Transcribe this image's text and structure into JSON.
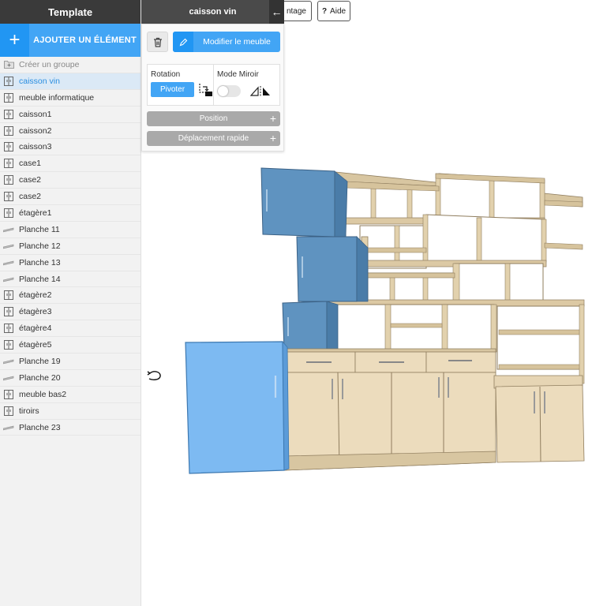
{
  "sidebar": {
    "title": "Template",
    "add_button": {
      "icon": "plus-icon",
      "label": "AJOUTER UN ÉLÉMENT"
    },
    "items": [
      {
        "label": "Créer un groupe",
        "icon": "folder-plus-icon",
        "kind": "group"
      },
      {
        "label": "caisson vin",
        "icon": "cabinet-icon",
        "kind": "selected"
      },
      {
        "label": "meuble informatique",
        "icon": "cabinet-icon",
        "kind": "normal"
      },
      {
        "label": "caisson1",
        "icon": "cabinet-icon",
        "kind": "normal"
      },
      {
        "label": "caisson2",
        "icon": "cabinet-icon",
        "kind": "normal"
      },
      {
        "label": "caisson3",
        "icon": "cabinet-icon",
        "kind": "normal"
      },
      {
        "label": "case1",
        "icon": "cabinet-icon",
        "kind": "normal"
      },
      {
        "label": "case2",
        "icon": "cabinet-icon",
        "kind": "normal"
      },
      {
        "label": "case2",
        "icon": "cabinet-icon",
        "kind": "normal"
      },
      {
        "label": "étagère1",
        "icon": "cabinet-icon",
        "kind": "normal"
      },
      {
        "label": "Planche 11",
        "icon": "plank-icon",
        "kind": "normal"
      },
      {
        "label": "Planche 12",
        "icon": "plank-icon",
        "kind": "normal"
      },
      {
        "label": "Planche 13",
        "icon": "plank-icon",
        "kind": "normal"
      },
      {
        "label": "Planche 14",
        "icon": "plank-icon",
        "kind": "normal"
      },
      {
        "label": "étagère2",
        "icon": "cabinet-icon",
        "kind": "normal"
      },
      {
        "label": "étagère3",
        "icon": "cabinet-icon",
        "kind": "normal"
      },
      {
        "label": "étagère4",
        "icon": "cabinet-icon",
        "kind": "normal"
      },
      {
        "label": "étagère5",
        "icon": "cabinet-icon",
        "kind": "normal"
      },
      {
        "label": "Planche 19",
        "icon": "plank-icon",
        "kind": "normal"
      },
      {
        "label": "Planche 20",
        "icon": "plank-icon",
        "kind": "normal"
      },
      {
        "label": "meuble bas2",
        "icon": "cabinet-icon",
        "kind": "normal"
      },
      {
        "label": "tiroirs",
        "icon": "cabinet-icon",
        "kind": "normal"
      },
      {
        "label": "Planche 23",
        "icon": "plank-icon",
        "kind": "normal"
      }
    ]
  },
  "topbar": {
    "selected_title": "caisson vin",
    "back_icon": "arrow-left-icon",
    "montage_label": "ntage",
    "aide_label": "Aide",
    "aide_icon": "question-icon"
  },
  "panel": {
    "delete_icon": "trash-icon",
    "edit_icon": "pencil-icon",
    "edit_label": "Modifier le meuble",
    "rotation_title": "Rotation",
    "pivot_label": "Pivoter",
    "mirror_title": "Mode Miroir",
    "mirror_enabled": false,
    "position_label": "Position",
    "quick_move_label": "Déplacement rapide"
  },
  "colors": {
    "accent": "#42a5f5",
    "accent_dark": "#2196f3",
    "header_dark": "#3a3a3a",
    "selected_bg": "#dbe9f6",
    "wood": "#e6d5b4",
    "door_blue": "#5f93c0",
    "door_selected": "#7dbaf2"
  }
}
